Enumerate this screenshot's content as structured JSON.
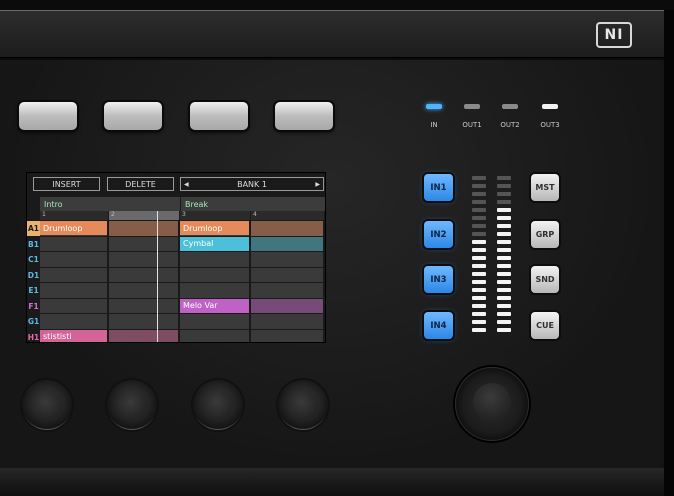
{
  "brand": {
    "logo_text": "NI"
  },
  "top_buttons": [
    {
      "id": "btn1"
    },
    {
      "id": "btn2"
    },
    {
      "id": "btn3"
    },
    {
      "id": "btn4"
    }
  ],
  "screen": {
    "insert_label": "INSERT",
    "delete_label": "DELETE",
    "bank_label": "BANK 1",
    "prev_arrow": "◀",
    "next_arrow": "▶",
    "scenes": [
      {
        "label": "Intro",
        "number": "1"
      },
      {
        "label": "",
        "number": "2"
      },
      {
        "label": "Break",
        "number": "3"
      },
      {
        "label": "",
        "number": "4"
      }
    ],
    "rows": [
      {
        "label": "A1",
        "color": "#e8b56e"
      },
      {
        "label": "B1",
        "color": "#5bb9e6"
      },
      {
        "label": "C1",
        "color": "#5bb9e6"
      },
      {
        "label": "D1",
        "color": "#5bb9e6"
      },
      {
        "label": "E1",
        "color": "#5bb9e6"
      },
      {
        "label": "F1",
        "color": "#d56ed8"
      },
      {
        "label": "G1",
        "color": "#5bb9e6"
      },
      {
        "label": "H1",
        "color": "#e86aa4"
      }
    ],
    "clips": [
      {
        "name": "Drumloop",
        "row": 0,
        "col": 0,
        "color": "#e58a5a"
      },
      {
        "name": "Drumloop",
        "row": 0,
        "col": 2,
        "color": "#e58a5a"
      },
      {
        "name": "Cymbal",
        "row": 1,
        "col": 2,
        "color": "#4cc0d8"
      },
      {
        "name": "Melo Var",
        "row": 5,
        "col": 2,
        "color": "#c061c6"
      },
      {
        "name": "stististi",
        "row": 7,
        "col": 0,
        "color": "#d46497"
      }
    ]
  },
  "routing": {
    "leds": [
      {
        "label": "IN",
        "color": "#4fb4ff"
      },
      {
        "label": "OUT1",
        "color": "#8a8a8a"
      },
      {
        "label": "OUT2",
        "color": "#8a8a8a"
      },
      {
        "label": "OUT3",
        "color": "#f2f2f2"
      }
    ],
    "input_buttons": [
      "IN1",
      "IN2",
      "IN3",
      "IN4"
    ],
    "side_buttons": [
      "MST",
      "GRP",
      "SND",
      "CUE"
    ],
    "meter_left_lit_fraction": 0.6,
    "meter_right_lit_fraction": 0.8,
    "meter_segments": 20
  }
}
